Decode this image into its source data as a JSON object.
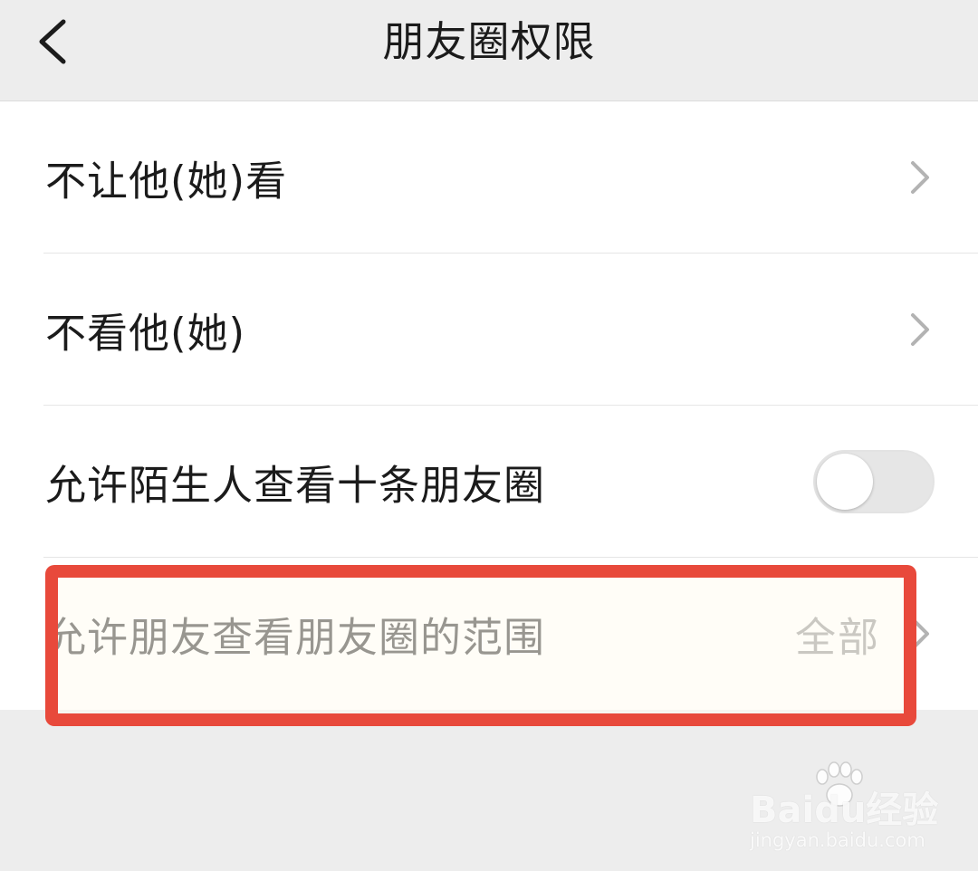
{
  "header": {
    "title": "朋友圈权限",
    "back_icon": "chevron-left-icon"
  },
  "settings": {
    "items": [
      {
        "label": "不让他(她)看",
        "control": "chevron-right-icon"
      },
      {
        "label": "不看他(她)",
        "control": "chevron-right-icon"
      },
      {
        "label": "允许陌生人查看十条朋友圈",
        "control": "toggle",
        "toggle_on": false
      },
      {
        "label": "允许朋友查看朋友圈的范围",
        "value": "全部",
        "control": "chevron-right-icon"
      }
    ]
  },
  "annotation": {
    "highlight_color": "#e8493b"
  },
  "watermark": {
    "brand": "Baidu经验",
    "url": "jingyan.baidu.com"
  },
  "colors": {
    "background": "#ededed",
    "card": "#ffffff",
    "text": "#1b1b1b",
    "secondary_text": "#8a8a8a"
  }
}
